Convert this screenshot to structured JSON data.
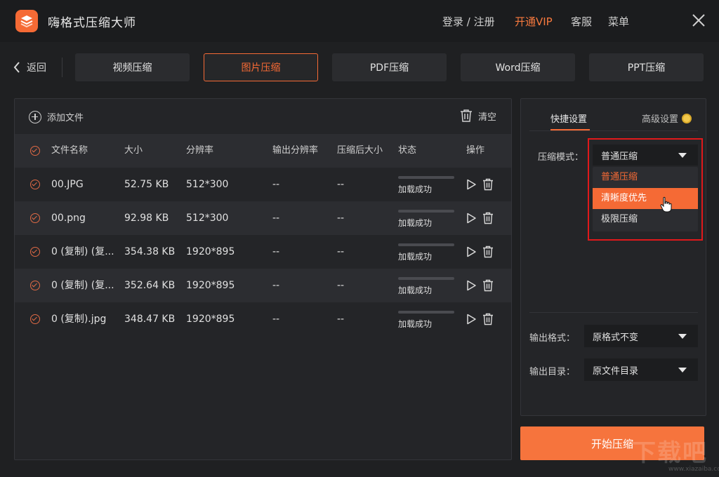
{
  "app": {
    "title": "嗨格式压缩大师",
    "menu": {
      "login": "登录 / 注册",
      "vip": "开通VIP",
      "service": "客服",
      "menu": "菜单"
    }
  },
  "nav": {
    "back": "返回",
    "tabs": [
      "视频压缩",
      "图片压缩",
      "PDF压缩",
      "Word压缩",
      "PPT压缩"
    ],
    "active_tab": "图片压缩"
  },
  "file_panel": {
    "add_file": "添加文件",
    "clear": "清空",
    "columns": [
      "文件名称",
      "大小",
      "分辨率",
      "输出分辨率",
      "压缩后大小",
      "状态",
      "操作"
    ],
    "rows": [
      {
        "name": "00.JPG",
        "size": "52.75 KB",
        "resolution": "512*300",
        "out_res": "--",
        "out_size": "--",
        "status": "加载成功"
      },
      {
        "name": "00.png",
        "size": "92.98 KB",
        "resolution": "512*300",
        "out_res": "--",
        "out_size": "--",
        "status": "加载成功"
      },
      {
        "name": "0 (复制) (复...",
        "size": "354.38 KB",
        "resolution": "1920*895",
        "out_res": "--",
        "out_size": "--",
        "status": "加载成功"
      },
      {
        "name": "0 (复制) (复...",
        "size": "352.64 KB",
        "resolution": "1920*895",
        "out_res": "--",
        "out_size": "--",
        "status": "加载成功"
      },
      {
        "name": "0 (复制).jpg",
        "size": "348.47 KB",
        "resolution": "1920*895",
        "out_res": "--",
        "out_size": "--",
        "status": "加载成功"
      }
    ]
  },
  "settings": {
    "tabs": {
      "quick": "快捷设置",
      "advanced": "高级设置"
    },
    "mode_label": "压缩模式：",
    "mode_value": "普通压缩",
    "mode_options": [
      "普通压缩",
      "清晰度优先",
      "极限压缩"
    ],
    "selected_option": "普通压缩",
    "hovered_option": "清晰度优先",
    "format_label": "输出格式：",
    "format_value": "原格式不变",
    "dir_label": "输出目录：",
    "dir_value": "原文件目录"
  },
  "start_button": "开始压缩",
  "watermark": "下载吧",
  "watermark_url": "www.xiazaiba.com",
  "colors": {
    "accent": "#f56a35",
    "highlight": "#e0191b",
    "bg": "#1f2022"
  }
}
